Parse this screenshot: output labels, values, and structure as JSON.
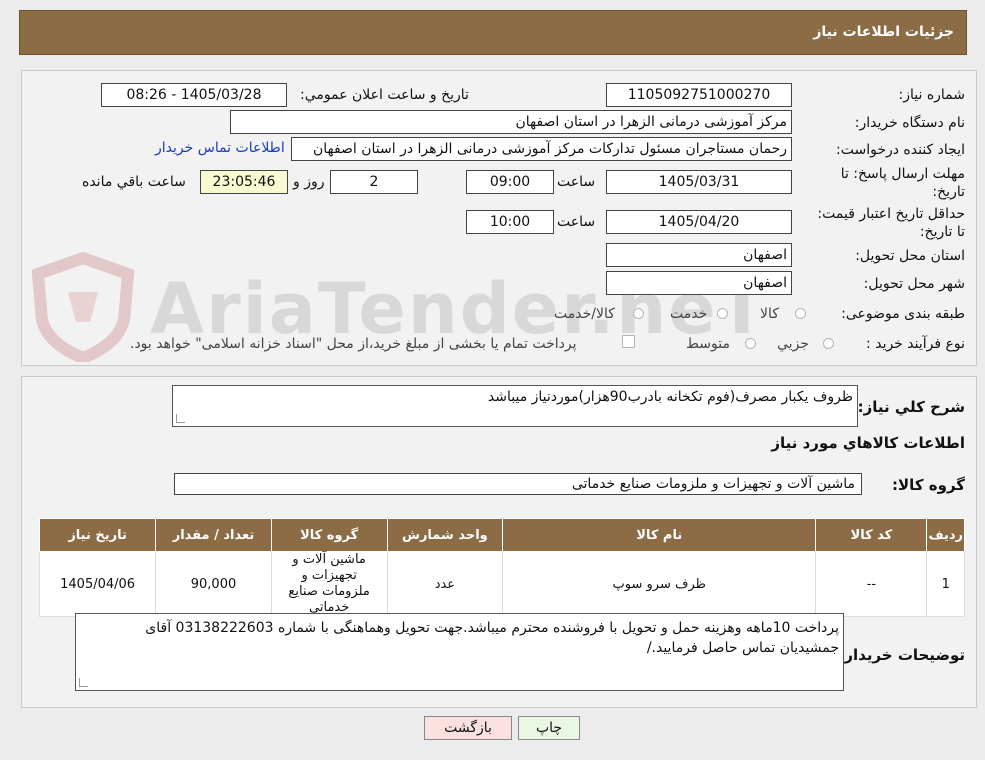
{
  "header": {
    "title": "جزئیات اطلاعات نیاز"
  },
  "form": {
    "need_number_label": "شماره نیاز:",
    "need_number": "1105092751000270",
    "announce_label": "تاریخ و ساعت اعلان عمومي:",
    "announce_value": "1405/03/28 - 08:26",
    "buyer_org_label": "نام دستگاه خريدار:",
    "buyer_org": "مرکز آموزشی درمانی الزهرا در استان اصفهان",
    "creator_label": "ايجاد کننده درخواست:",
    "creator": "رحمان مستاجران مسئول تداركات مرکز آموزشی درمانی الزهرا در استان اصفهان",
    "contact_link": "اطلاعات تماس خريدار",
    "deadline_label": "مهلت ارسال پاسخ: تا تاریخ:",
    "deadline_date": "1405/03/31",
    "time_label": "ساعت",
    "deadline_time": "09:00",
    "days_value": "2",
    "days_label": "روز و",
    "remaining_value": "23:05:46",
    "remaining_label": "ساعت باقي مانده",
    "validity_label": "حداقل تاریخ اعتبار قیمت: تا تاریخ:",
    "validity_date": "1405/04/20",
    "validity_time": "10:00",
    "province_label": "استان محل تحويل:",
    "province": "اصفهان",
    "city_label": "شهر محل تحويل:",
    "city": "اصفهان",
    "category_label": "طبقه بندی موضوعی:",
    "category_options": [
      "کالا",
      "خدمت",
      "کالا/خدمت"
    ],
    "process_label": "نوع فرآيند خريد :",
    "process_options": [
      "جزيي",
      "متوسط"
    ],
    "payment_note": "پرداخت تمام يا بخشی از مبلغ خريد،از محل \"اسناد خزانه اسلامی\" خواهد بود."
  },
  "watermark": "AriaTender.neT",
  "description": {
    "label": "شرح کلي نياز:",
    "value": "ظروف یکبار مصرف(فوم تکخانه بادرب90هزار)موردنیاز میباشد"
  },
  "goods": {
    "section_title": "اطلاعات کالاهاي مورد نياز",
    "group_label": "گروه کالا:",
    "group_value": "ماشین آلات و تجهیزات و ملزومات صنایع خدماتی"
  },
  "table": {
    "headers": [
      "رديف",
      "کد کالا",
      "نام کالا",
      "واحد شمارش",
      "گروه کالا",
      "تعداد / مقدار",
      "تاريخ نياز"
    ],
    "rows": [
      [
        "1",
        "--",
        "ظرف سرو سوپ",
        "عدد",
        "ماشین آلات و تجهیزات و ملزومات صنایع خدماتی",
        "90,000",
        "1405/04/06"
      ]
    ]
  },
  "buyer_notes": {
    "label": "توضيحات خريدار:",
    "value": "پرداخت 10ماهه وهزینه حمل و تحویل با فروشنده محترم میباشد.جهت تحویل وهماهنگی با شماره 03138222603 آقای جمشیدیان تماس حاصل فرمایید./"
  },
  "buttons": {
    "print": "چاپ",
    "back": "بازگشت"
  },
  "colors": {
    "header_bg": "#8b6c45",
    "print_bg": "#eaf7e4",
    "back_bg": "#fbe0e0",
    "remaining_bg": "#fafad2"
  }
}
